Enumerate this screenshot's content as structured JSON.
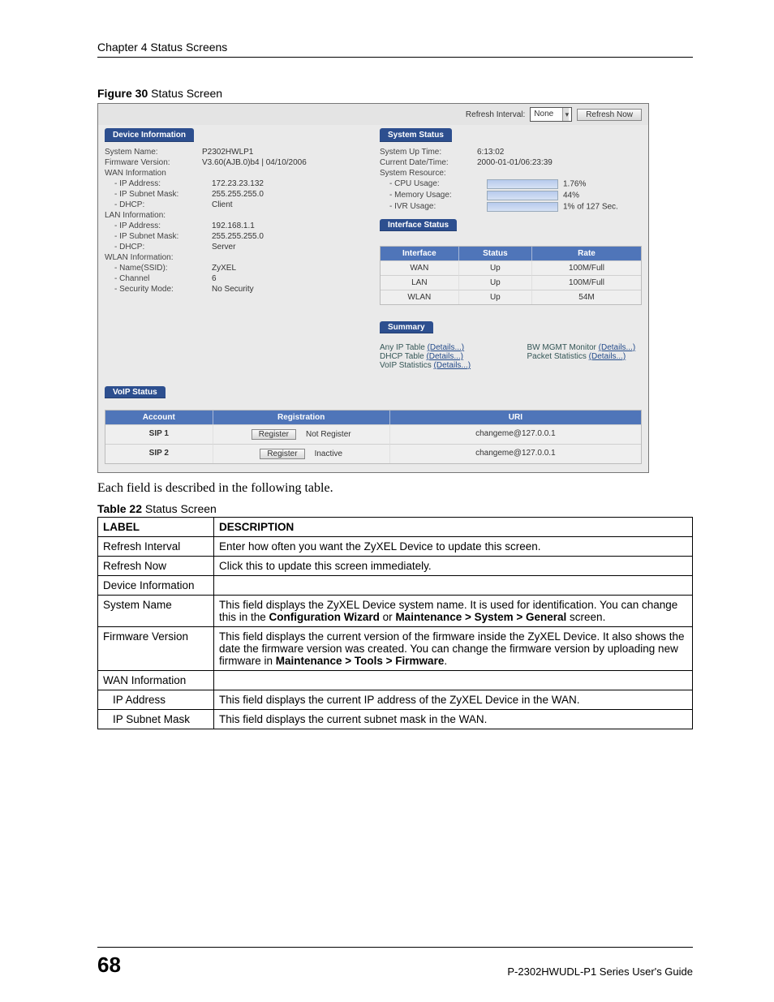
{
  "chapter": "Chapter 4 Status Screens",
  "figure_caption_bold": "Figure 30",
  "figure_caption_rest": "   Status Screen",
  "topbar": {
    "refresh_label": "Refresh Interval:",
    "refresh_value": "None",
    "refresh_now": "Refresh Now"
  },
  "device_info": {
    "header": "Device Information",
    "rows": [
      {
        "k": "System Name:",
        "v": "P2302HWLP1"
      },
      {
        "k": "Firmware Version:",
        "v": "V3.60(AJB.0)b4 | 04/10/2006"
      },
      {
        "k": "WAN Information",
        "v": ""
      },
      {
        "k": "- IP Address:",
        "v": "172.23.23.132",
        "indent": true
      },
      {
        "k": "- IP Subnet Mask:",
        "v": "255.255.255.0",
        "indent": true
      },
      {
        "k": "- DHCP:",
        "v": "Client",
        "indent": true
      },
      {
        "k": "LAN Information:",
        "v": ""
      },
      {
        "k": "- IP Address:",
        "v": "192.168.1.1",
        "indent": true
      },
      {
        "k": "- IP Subnet Mask:",
        "v": "255.255.255.0",
        "indent": true
      },
      {
        "k": "- DHCP:",
        "v": "Server",
        "indent": true
      },
      {
        "k": "WLAN Information:",
        "v": ""
      },
      {
        "k": "- Name(SSID):",
        "v": "ZyXEL",
        "indent": true
      },
      {
        "k": "- Channel",
        "v": "6",
        "indent": true
      },
      {
        "k": "- Security Mode:",
        "v": "No Security",
        "indent": true
      }
    ]
  },
  "system_status": {
    "header": "System Status",
    "rows": [
      {
        "k": "System Up Time:",
        "v": "6:13:02"
      },
      {
        "k": "Current Date/Time:",
        "v": "2000-01-01/06:23:39"
      },
      {
        "k": "System Resource:",
        "v": ""
      },
      {
        "k": "- CPU Usage:",
        "bar": true,
        "v": "1.76%",
        "indent": true
      },
      {
        "k": "- Memory Usage:",
        "bar": true,
        "v": "44%",
        "indent": true
      },
      {
        "k": "- IVR Usage:",
        "bar": true,
        "v": "1% of 127 Sec.",
        "indent": true
      }
    ]
  },
  "interface_status": {
    "header": "Interface Status",
    "cols": [
      "Interface",
      "Status",
      "Rate"
    ],
    "rows": [
      [
        "WAN",
        "Up",
        "100M/Full"
      ],
      [
        "LAN",
        "Up",
        "100M/Full"
      ],
      [
        "WLAN",
        "Up",
        "54M"
      ]
    ]
  },
  "summary": {
    "header": "Summary",
    "left": [
      {
        "t": "Any IP Table ",
        "l": "(Details...)"
      },
      {
        "t": "DHCP Table ",
        "l": "(Details...)"
      },
      {
        "t": "VoIP Statistics ",
        "l": "(Details...)"
      }
    ],
    "right": [
      {
        "t": "BW MGMT Monitor ",
        "l": "(Details...)"
      },
      {
        "t": "Packet Statistics ",
        "l": "(Details...)"
      }
    ]
  },
  "voip": {
    "header": "VoIP Status",
    "cols": [
      "Account",
      "Registration",
      "URI"
    ],
    "rows": [
      {
        "acct": "SIP 1",
        "btn": "Register",
        "reg": "Not Register",
        "uri": "changeme@127.0.0.1"
      },
      {
        "acct": "SIP 2",
        "btn": "Register",
        "reg": "Inactive",
        "uri": "changeme@127.0.0.1"
      }
    ]
  },
  "body_following": "Each field is described in the following table.",
  "table_caption_bold": "Table 22",
  "table_caption_rest": "   Status Screen",
  "desc_table": {
    "headers": [
      "LABEL",
      "DESCRIPTION"
    ],
    "rows": [
      {
        "l": "Refresh Interval",
        "d": "Enter how often you want the ZyXEL Device to update this screen."
      },
      {
        "l": "Refresh Now",
        "d": "Click this to update this screen immediately."
      },
      {
        "l": "Device Information",
        "d": ""
      },
      {
        "l": "System Name",
        "d": "This field displays the ZyXEL Device system name. It is used for identification. You can change this in the <b>Configuration Wizard</b> or <b>Maintenance > System > General</b> screen."
      },
      {
        "l": "Firmware Version",
        "d": "This field displays the current version of the firmware inside the ZyXEL Device. It also shows the date the firmware version was created. You can change the firmware version by uploading new firmware in <b>Maintenance > Tools > Firmware</b>."
      },
      {
        "l": "WAN Information",
        "d": ""
      },
      {
        "l": "IP Address",
        "indent": true,
        "d": "This field displays the current IP address of the ZyXEL Device in the WAN."
      },
      {
        "l": "IP Subnet Mask",
        "indent": true,
        "d": "This field displays the current subnet mask in the WAN."
      }
    ]
  },
  "page_number": "68",
  "guide": "P-2302HWUDL-P1 Series User's Guide"
}
